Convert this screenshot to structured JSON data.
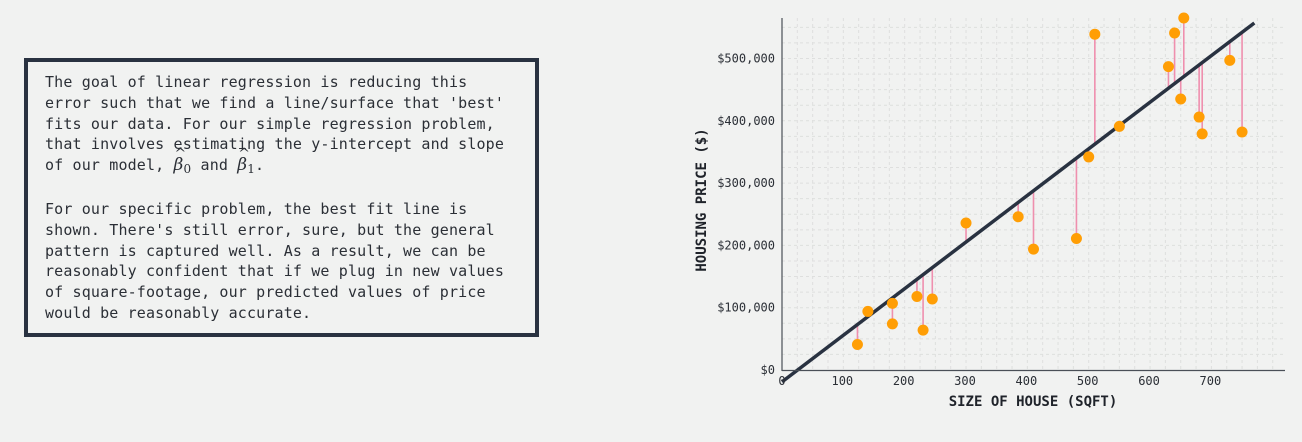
{
  "explanation": {
    "paragraph1_text": "The goal of linear regression is reducing this error such that we find a line/surface that 'best' fits our data. For our simple regression problem, that involves estimating the y-intercept and slope of our model,",
    "beta0_symbol": "β",
    "beta0_subscript": "0",
    "conjunction": "and",
    "beta1_symbol": "β",
    "beta1_subscript": "1",
    "paragraph1_end": ".",
    "paragraph2_text": "For our specific problem, the best fit line is shown. There's still error, sure, but the general pattern is captured well. As a result, we can be reasonably confident that if we plug in new values of square-footage, our predicted values of price would be reasonably accurate."
  },
  "chart_data": {
    "type": "scatter",
    "xlabel": "SIZE OF HOUSE (SQFT)",
    "ylabel": "HOUSING PRICE ($)",
    "xlim": [
      0,
      820
    ],
    "ylim": [
      0,
      565000
    ],
    "x_ticks": [
      0,
      100,
      200,
      300,
      400,
      500,
      600,
      700
    ],
    "x_tick_labels": [
      "0",
      "100",
      "200",
      "300",
      "400",
      "500",
      "600",
      "700"
    ],
    "y_ticks": [
      0,
      100000,
      200000,
      300000,
      400000,
      500000
    ],
    "y_tick_labels": [
      "$0",
      "$100,000",
      "$200,000",
      "$300,000",
      "$400,000",
      "$500,000"
    ],
    "grid": true,
    "regression_line": {
      "x": [
        0,
        770
      ],
      "y": [
        -19000,
        557000
      ]
    },
    "points": [
      {
        "x": 123,
        "y": 41000
      },
      {
        "x": 140,
        "y": 94000
      },
      {
        "x": 180,
        "y": 107000
      },
      {
        "x": 180,
        "y": 74000
      },
      {
        "x": 220,
        "y": 118000
      },
      {
        "x": 230,
        "y": 64000
      },
      {
        "x": 245,
        "y": 114000
      },
      {
        "x": 300,
        "y": 236000
      },
      {
        "x": 385,
        "y": 246000
      },
      {
        "x": 410,
        "y": 194000
      },
      {
        "x": 480,
        "y": 211000
      },
      {
        "x": 500,
        "y": 342000
      },
      {
        "x": 510,
        "y": 539000
      },
      {
        "x": 550,
        "y": 391000
      },
      {
        "x": 630,
        "y": 487000
      },
      {
        "x": 640,
        "y": 541000
      },
      {
        "x": 650,
        "y": 435000
      },
      {
        "x": 655,
        "y": 565000
      },
      {
        "x": 680,
        "y": 406000
      },
      {
        "x": 685,
        "y": 379000
      },
      {
        "x": 730,
        "y": 497000
      },
      {
        "x": 750,
        "y": 382000
      }
    ],
    "colors": {
      "point": "#ff9e05",
      "residual": "#ef8fae",
      "line": "#293241",
      "grid": "#dedfde",
      "axis": "#4a4f57"
    }
  }
}
